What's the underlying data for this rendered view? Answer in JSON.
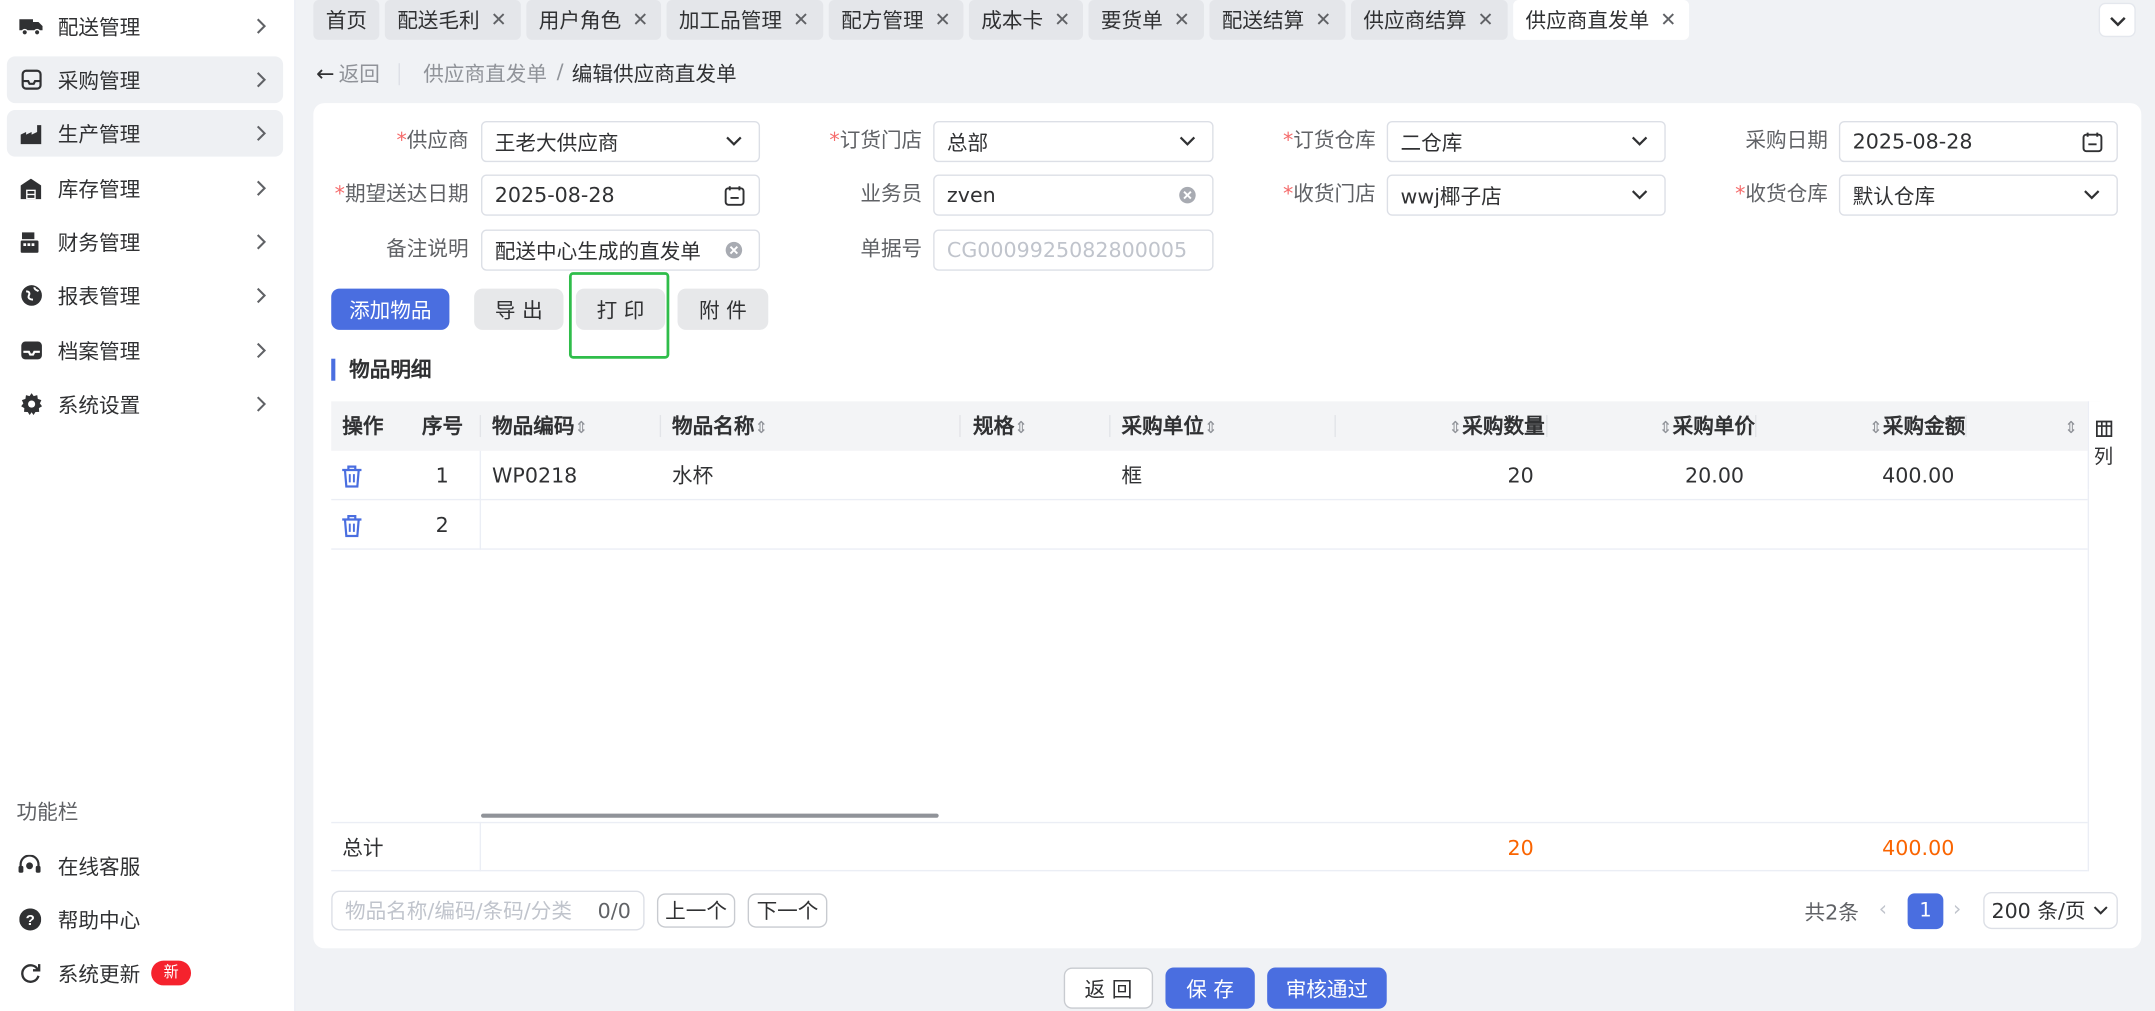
{
  "sidebar": {
    "items": [
      {
        "label": "配送管理",
        "icon": "truck-icon"
      },
      {
        "label": "采购管理",
        "icon": "inbox-icon"
      },
      {
        "label": "生产管理",
        "icon": "factory-icon"
      },
      {
        "label": "库存管理",
        "icon": "warehouse-icon"
      },
      {
        "label": "财务管理",
        "icon": "cash-register-icon"
      },
      {
        "label": "报表管理",
        "icon": "globe-icon"
      },
      {
        "label": "档案管理",
        "icon": "archive-icon"
      },
      {
        "label": "系统设置",
        "icon": "gear-icon"
      }
    ],
    "func_title": "功能栏",
    "utils": [
      {
        "label": "在线客服",
        "icon": "headset-icon"
      },
      {
        "label": "帮助中心",
        "icon": "help-icon"
      },
      {
        "label": "系统更新",
        "icon": "refresh-icon",
        "badge": "新"
      }
    ]
  },
  "tabs": [
    {
      "label": "首页"
    },
    {
      "label": "配送毛利"
    },
    {
      "label": "用户角色"
    },
    {
      "label": "加工品管理"
    },
    {
      "label": "配方管理"
    },
    {
      "label": "成本卡"
    },
    {
      "label": "要货单"
    },
    {
      "label": "配送结算"
    },
    {
      "label": "供应商结算"
    },
    {
      "label": "供应商直发单"
    }
  ],
  "header": {
    "back_label": "返回",
    "breadcrumb_parent": "供应商直发单",
    "breadcrumb_sep": "/",
    "breadcrumb_current": "编辑供应商直发单"
  },
  "form": {
    "supplier_label": "供应商",
    "supplier_value": "王老大供应商",
    "order_store_label": "订货门店",
    "order_store_value": "总部",
    "order_wh_label": "订货仓库",
    "order_wh_value": "二仓库",
    "purchase_date_label": "采购日期",
    "purchase_date_value": "2025-08-28",
    "expect_date_label": "期望送达日期",
    "expect_date_value": "2025-08-28",
    "salesman_label": "业务员",
    "salesman_value": "zven",
    "recv_store_label": "收货门店",
    "recv_store_value": "wwj椰子店",
    "recv_wh_label": "收货仓库",
    "recv_wh_value": "默认仓库",
    "remark_label": "备注说明",
    "remark_value": "配送中心生成的直发单",
    "doc_no_label": "单据号",
    "doc_no_placeholder": "CG0009925082800005"
  },
  "toolbar": {
    "add_label": "添加物品",
    "export_label": "导 出",
    "print_label": "打 印",
    "attach_label": "附 件"
  },
  "section_title": "物品明细",
  "table": {
    "columns": [
      "操作",
      "序号",
      "物品编码",
      "物品名称",
      "规格",
      "采购单位",
      "采购数量",
      "采购单价",
      "采购金额"
    ],
    "rows": [
      {
        "seq": "1",
        "code": "WP0218",
        "name": "水杯",
        "spec": "",
        "unit": "框",
        "qty": "20",
        "price": "20.00",
        "amount": "400.00"
      },
      {
        "seq": "2",
        "code": "",
        "name": "",
        "spec": "",
        "unit": "",
        "qty": "",
        "price": "",
        "amount": ""
      }
    ],
    "footer_label": "总计",
    "footer_qty": "20",
    "footer_amount": "400.00",
    "column_toggle": "列"
  },
  "pager": {
    "search_placeholder": "物品名称/编码/条码/分类",
    "search_count": "0/0",
    "prev_item": "上一个",
    "next_item": "下一个",
    "total": "共2条",
    "current_page": "1",
    "page_size": "200 条/页"
  },
  "bottom": {
    "back_label": "返 回",
    "save_label": "保 存",
    "approve_label": "审核通过"
  },
  "colors": {
    "primary": "#4a6ee0",
    "highlight": "#2fbd4a",
    "orange": "#fa6400",
    "required": "#f56c6c"
  }
}
